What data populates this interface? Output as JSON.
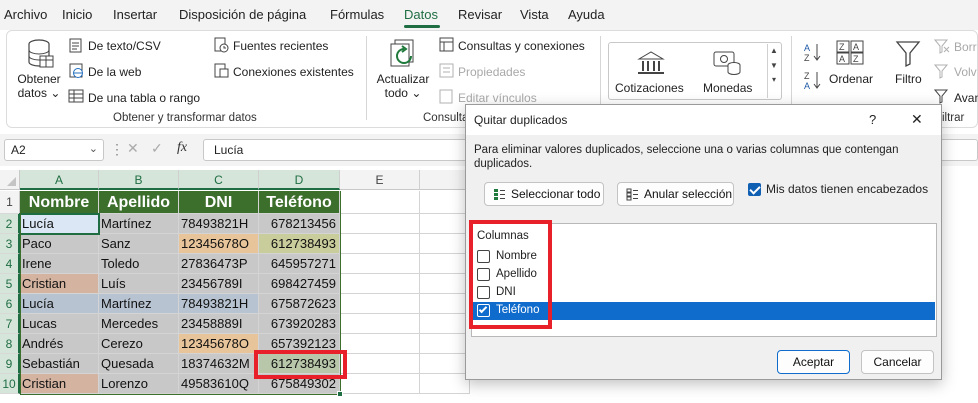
{
  "menu": [
    "Archivo",
    "Inicio",
    "Insertar",
    "Disposición de página",
    "Fórmulas",
    "Datos",
    "Revisar",
    "Vista",
    "Ayuda"
  ],
  "ribbon": {
    "obtener_datos": [
      "Obtener",
      "datos ⌄"
    ],
    "from_text": "De texto/CSV",
    "from_web": "De la web",
    "from_table": "De una tabla o rango",
    "recent_sources": "Fuentes recientes",
    "existing_connections": "Conexiones existentes",
    "group1_label": "Obtener y transformar datos",
    "actualizar": [
      "Actualizar",
      "todo ⌄"
    ],
    "queries_connections": "Consultas y conexiones",
    "properties": "Propiedades",
    "edit_links": "Editar vínculos",
    "group2_label": "Consultas",
    "cotizaciones": "Cotizaciones",
    "monedas": "Monedas",
    "ordenar": "Ordenar",
    "filtro": "Filtro",
    "borrar": "Borr",
    "volver": "Volv",
    "avanzadas": "Avan",
    "group5_label": "iltrar"
  },
  "formula_bar": {
    "name_box": "A2",
    "fx": "fx",
    "formula": "Lucía"
  },
  "sheet": {
    "columns": [
      "A",
      "B",
      "C",
      "D",
      "E"
    ],
    "rows": [
      "1",
      "2",
      "3",
      "4",
      "5",
      "6",
      "7",
      "8",
      "9",
      "10"
    ],
    "headers": [
      "Nombre",
      "Apellido",
      "DNI",
      "Teléfono"
    ],
    "data": [
      [
        "Lucía",
        "Martínez",
        "78493821H",
        "678213456"
      ],
      [
        "Paco",
        "Sanz",
        "12345678O",
        "612738493"
      ],
      [
        "Irene",
        "Toledo",
        "27836473P",
        "645957271"
      ],
      [
        "Cristian",
        "Luís",
        "23456789I",
        "698427459"
      ],
      [
        "Lucía",
        "Martínez",
        "78493821H",
        "675872623"
      ],
      [
        "Lucas",
        "Mercedes",
        "23458889I",
        "673920283"
      ],
      [
        "Andrés",
        "Cerezo",
        "12345678O",
        "657392123"
      ],
      [
        "Sebastián",
        "Quesada",
        "18374632M",
        "612738493"
      ],
      [
        "Cristian",
        "Lorenzo",
        "49583610Q",
        "675849302"
      ]
    ],
    "colors": {
      "header_green": "#3c6e2c",
      "selected_blue": "#dbe7f4",
      "gray": "#c8c8c8",
      "blue_gray": "#b7c3d1",
      "tan": "#d4b3a0",
      "orange": "#e8c49a",
      "green_gray": "#b8c6aa",
      "olive": "#c9cc9b"
    }
  },
  "dialog": {
    "title": "Quitar duplicados",
    "help": "?",
    "close": "✕",
    "description": "Para eliminar valores duplicados, seleccione una o varias columnas que contengan duplicados.",
    "select_all": "Seleccionar todo",
    "unselect_all": "Anular selección",
    "has_headers": "Mis datos tienen encabezados",
    "has_headers_checked": true,
    "columns_label": "Columnas",
    "columns": [
      {
        "label": "Nombre",
        "checked": false
      },
      {
        "label": "Apellido",
        "checked": false
      },
      {
        "label": "DNI",
        "checked": false
      },
      {
        "label": "Teléfono",
        "checked": true
      }
    ],
    "ok": "Aceptar",
    "cancel": "Cancelar"
  }
}
